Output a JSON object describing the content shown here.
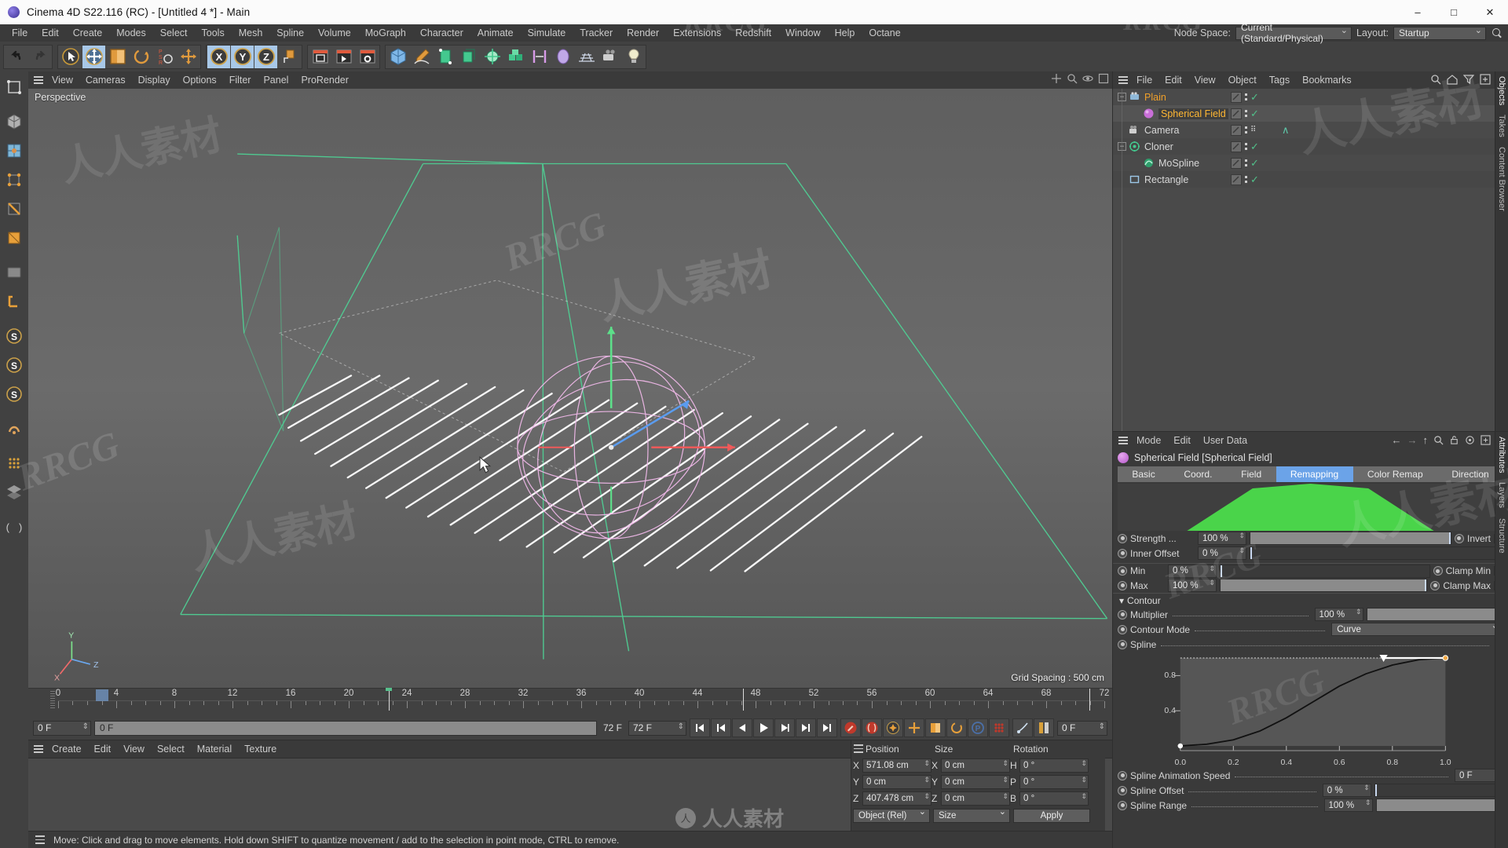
{
  "window": {
    "title": "Cinema 4D S22.116 (RC) - [Untitled 4 *] - Main",
    "minimize": "–",
    "maximize": "□",
    "close": "✕"
  },
  "menubar": {
    "items": [
      "File",
      "Edit",
      "Create",
      "Modes",
      "Select",
      "Tools",
      "Mesh",
      "Spline",
      "Volume",
      "MoGraph",
      "Character",
      "Animate",
      "Simulate",
      "Tracker",
      "Render",
      "Extensions",
      "Redshift",
      "Window",
      "Help",
      "Octane"
    ],
    "node_space_label": "Node Space:",
    "node_space_value": "Current (Standard/Physical)",
    "layout_label": "Layout:",
    "layout_value": "Startup"
  },
  "toolbar": {
    "groups": [
      {
        "name": "history",
        "buttons": [
          {
            "name": "undo-button",
            "icon": "undo"
          },
          {
            "name": "redo-button",
            "icon": "redo"
          }
        ]
      },
      {
        "name": "transform",
        "buttons": [
          {
            "name": "select-tool-button",
            "icon": "cursor"
          },
          {
            "name": "move-tool-button",
            "icon": "move",
            "active": true
          },
          {
            "name": "scale-tool-button",
            "icon": "scale"
          },
          {
            "name": "rotate-tool-button",
            "icon": "rotate"
          },
          {
            "name": "psr-button",
            "icon": "psr"
          },
          {
            "name": "world-axis-button",
            "icon": "axis"
          }
        ]
      },
      {
        "name": "axis-lock",
        "buttons": [
          {
            "name": "lock-x-button",
            "icon": "x",
            "active": true
          },
          {
            "name": "lock-y-button",
            "icon": "y",
            "active": true
          },
          {
            "name": "lock-z-button",
            "icon": "z",
            "active": true
          },
          {
            "name": "world-object-button",
            "icon": "cube-axis"
          }
        ]
      },
      {
        "name": "render",
        "buttons": [
          {
            "name": "render-view-button",
            "icon": "render-view"
          },
          {
            "name": "render-to-picture-button",
            "icon": "render-picture"
          },
          {
            "name": "render-settings-button",
            "icon": "render-settings"
          }
        ]
      },
      {
        "name": "create",
        "buttons": [
          {
            "name": "add-cube-button",
            "icon": "cube"
          },
          {
            "name": "add-spline-button",
            "icon": "pen"
          },
          {
            "name": "nurbs-button",
            "icon": "nurbs"
          },
          {
            "name": "array-button",
            "icon": "array"
          },
          {
            "name": "deformer-button",
            "icon": "deformer"
          },
          {
            "name": "mograph-button",
            "icon": "mograph"
          },
          {
            "name": "scene-button",
            "icon": "scene"
          },
          {
            "name": "field-button",
            "icon": "field"
          },
          {
            "name": "floor-button",
            "icon": "floor"
          },
          {
            "name": "camera-button",
            "icon": "camera"
          },
          {
            "name": "light-button",
            "icon": "light"
          }
        ]
      }
    ]
  },
  "left_tools": [
    {
      "name": "make-editable-button",
      "icon": "editable"
    },
    {
      "name": "model-mode-button",
      "icon": "model"
    },
    {
      "name": "texture-mode-button",
      "icon": "texture"
    },
    {
      "name": "points-mode-button",
      "icon": "points"
    },
    {
      "name": "edges-mode-button",
      "icon": "edges"
    },
    {
      "name": "polygons-mode-button",
      "icon": "polygons"
    },
    {
      "name": "workplane-button",
      "icon": "workplane"
    },
    {
      "name": "axis-mode-button",
      "icon": "axis-mode"
    },
    {
      "name": "enable-axis-button",
      "icon": "s1"
    },
    {
      "name": "enable-snap-button",
      "icon": "s2"
    },
    {
      "name": "enable-quantize-button",
      "icon": "s3"
    },
    {
      "name": "viewport-solo-button",
      "icon": "solo"
    },
    {
      "name": "soft-selection-button",
      "icon": "softsel"
    },
    {
      "name": "layer-button",
      "icon": "layers"
    },
    {
      "name": "script-button",
      "icon": "script"
    }
  ],
  "viewport": {
    "menu": [
      "View",
      "Cameras",
      "Display",
      "Options",
      "Filter",
      "Panel",
      "ProRender"
    ],
    "label": "Perspective",
    "grid_spacing": "Grid Spacing : 500 cm",
    "axis_labels": {
      "x": "X",
      "y": "Y",
      "z": "Z"
    }
  },
  "timeline": {
    "ticks": [
      "0",
      "4",
      "8",
      "12",
      "16",
      "20",
      "24",
      "28",
      "32",
      "36",
      "40",
      "44",
      "48",
      "52",
      "56",
      "60",
      "64",
      "68",
      "72"
    ],
    "current_frame_field": "0 F",
    "current_frame_slot": "0 F",
    "end_frame_label": "72 F",
    "end_frame_field": "72 F",
    "preview_end_field": "0 F",
    "playhead_frame": "24",
    "transport": [
      {
        "name": "goto-start-button",
        "icon": "skip-start"
      },
      {
        "name": "goto-prev-key-button",
        "icon": "prev-key"
      },
      {
        "name": "step-back-button",
        "icon": "step-back"
      },
      {
        "name": "play-button",
        "icon": "play"
      },
      {
        "name": "step-forward-button",
        "icon": "step-fwd"
      },
      {
        "name": "goto-next-key-button",
        "icon": "next-key"
      },
      {
        "name": "goto-end-button",
        "icon": "skip-end"
      }
    ],
    "record_tools": [
      {
        "name": "record-active-objects-button",
        "icon": "record-key"
      },
      {
        "name": "autokeying-button",
        "icon": "autokey"
      },
      {
        "name": "keyframe-selection-button",
        "icon": "key-select"
      },
      {
        "name": "position-key-button",
        "icon": "pos-key"
      },
      {
        "name": "scale-key-button",
        "icon": "scale-key"
      },
      {
        "name": "rotation-key-button",
        "icon": "rot-key"
      },
      {
        "name": "param-key-button",
        "icon": "param-key"
      },
      {
        "name": "pla-key-button",
        "icon": "pla-key"
      }
    ],
    "extra_tools": [
      {
        "name": "dynamics-button",
        "icon": "dynamics"
      },
      {
        "name": "timeline-button",
        "icon": "timeline"
      }
    ]
  },
  "material_manager": {
    "menu": [
      "Create",
      "Edit",
      "View",
      "Select",
      "Material",
      "Texture"
    ]
  },
  "coordinates": {
    "title_position": "Position",
    "title_size": "Size",
    "title_rotation": "Rotation",
    "rows": [
      {
        "axis": "X",
        "position": "571.08 cm",
        "size_axis": "X",
        "size": "0 cm",
        "rot_axis": "H",
        "rotation": "0 °"
      },
      {
        "axis": "Y",
        "position": "0 cm",
        "size_axis": "Y",
        "size": "0 cm",
        "rot_axis": "P",
        "rotation": "0 °"
      },
      {
        "axis": "Z",
        "position": "407.478 cm",
        "size_axis": "Z",
        "size": "0 cm",
        "rot_axis": "B",
        "rotation": "0 °"
      }
    ],
    "mode_dropdown": "Object (Rel)",
    "size_dropdown": "Size",
    "apply_button": "Apply"
  },
  "statusbar": {
    "message": "Move: Click and drag to move elements. Hold down SHIFT to quantize movement / add to the selection in point mode, CTRL to remove."
  },
  "object_manager": {
    "menu": [
      "File",
      "Edit",
      "View",
      "Object",
      "Tags",
      "Bookmarks"
    ],
    "icons": [
      "search-icon",
      "home-icon",
      "filter-icon",
      "add-icon"
    ],
    "rows": [
      {
        "name": "Plain",
        "indent": 0,
        "icon": "plain-effector",
        "has_toggle": true,
        "highlight": true,
        "selected": false,
        "tag": "check"
      },
      {
        "name": "Spherical Field",
        "indent": 1,
        "icon": "spherical-field",
        "has_toggle": false,
        "highlight": true,
        "selected": true,
        "tag": "check"
      },
      {
        "name": "Camera",
        "indent": 0,
        "icon": "camera",
        "has_toggle": false,
        "highlight": false,
        "selected": false,
        "tag": "dots"
      },
      {
        "name": "Cloner",
        "indent": 0,
        "icon": "cloner",
        "has_toggle": true,
        "highlight": false,
        "selected": false,
        "tag": "check"
      },
      {
        "name": "MoSpline",
        "indent": 1,
        "icon": "mospline",
        "has_toggle": false,
        "highlight": false,
        "selected": false,
        "tag": "check"
      },
      {
        "name": "Rectangle",
        "indent": 0,
        "icon": "rectangle",
        "has_toggle": false,
        "highlight": false,
        "selected": false,
        "tag": "check"
      }
    ],
    "side_tabs": [
      "Objects",
      "Takes",
      "Content Browser"
    ]
  },
  "attributes": {
    "menu": [
      "Mode",
      "Edit",
      "User Data"
    ],
    "object_title": "Spherical Field [Spherical Field]",
    "tabs": [
      "Basic",
      "Coord.",
      "Field",
      "Remapping",
      "Color Remap",
      "Direction"
    ],
    "active_tab": "Remapping",
    "fields": [
      {
        "label": "Strength ...",
        "value": "100 %",
        "slider": 100,
        "extra_label": "Invert",
        "extra_checked": false
      },
      {
        "label": "Inner Offset",
        "value": "0 %",
        "slider": 0
      },
      {
        "label": "Min",
        "value": "0 %",
        "slider": 0,
        "extra_label": "Clamp Min",
        "extra_checked": true
      },
      {
        "label": "Max",
        "value": "100 %",
        "slider": 100,
        "extra_label": "Clamp Max",
        "extra_checked": true
      }
    ],
    "contour_section": "Contour",
    "contour_fields": [
      {
        "label": "Multiplier",
        "value": "100 %",
        "slider": 100,
        "type": "slider"
      },
      {
        "label": "Contour Mode",
        "value": "Curve",
        "type": "dropdown"
      },
      {
        "label": "Spline",
        "value": "",
        "type": "expander"
      }
    ],
    "spline_fields": [
      {
        "label": "Spline Animation Speed",
        "value": "0 F",
        "type": "number"
      },
      {
        "label": "Spline Offset",
        "value": "0 %",
        "slider": 0,
        "type": "slider"
      },
      {
        "label": "Spline Range",
        "value": "100 %",
        "slider": 100,
        "type": "slider"
      }
    ],
    "side_tabs": [
      "Attributes",
      "Layers",
      "Structure"
    ]
  },
  "chart_data": [
    {
      "type": "area",
      "name": "field-falloff-preview",
      "title": "",
      "x": [
        0,
        0.18,
        0.35,
        0.5,
        0.65,
        0.82,
        1.0
      ],
      "values": [
        0,
        0,
        0.9,
        1.0,
        0.9,
        0,
        0
      ],
      "color": "#4ad44a",
      "xlabel": "",
      "ylabel": "",
      "grid": false
    },
    {
      "type": "line",
      "name": "contour-spline-curve",
      "title": "",
      "x": [
        0.0,
        0.1,
        0.2,
        0.3,
        0.4,
        0.5,
        0.6,
        0.7,
        0.8,
        0.9,
        1.0
      ],
      "values": [
        0.0,
        0.02,
        0.07,
        0.17,
        0.32,
        0.5,
        0.68,
        0.82,
        0.92,
        0.98,
        1.0
      ],
      "xticks": [
        "0.0",
        "0.2",
        "0.4",
        "0.6",
        "0.8",
        "1.0"
      ],
      "yticks": [
        "0.4",
        "0.8"
      ],
      "xlim": [
        0,
        1
      ],
      "ylim": [
        0,
        1
      ],
      "grid": true,
      "legend": "none",
      "knots": [
        {
          "x": 0.0,
          "y": 0.0
        },
        {
          "x": 1.0,
          "y": 1.0
        }
      ]
    }
  ],
  "watermarks": {
    "cn": "人人素材",
    "en": "RRCG",
    "brand": "人人素材"
  }
}
